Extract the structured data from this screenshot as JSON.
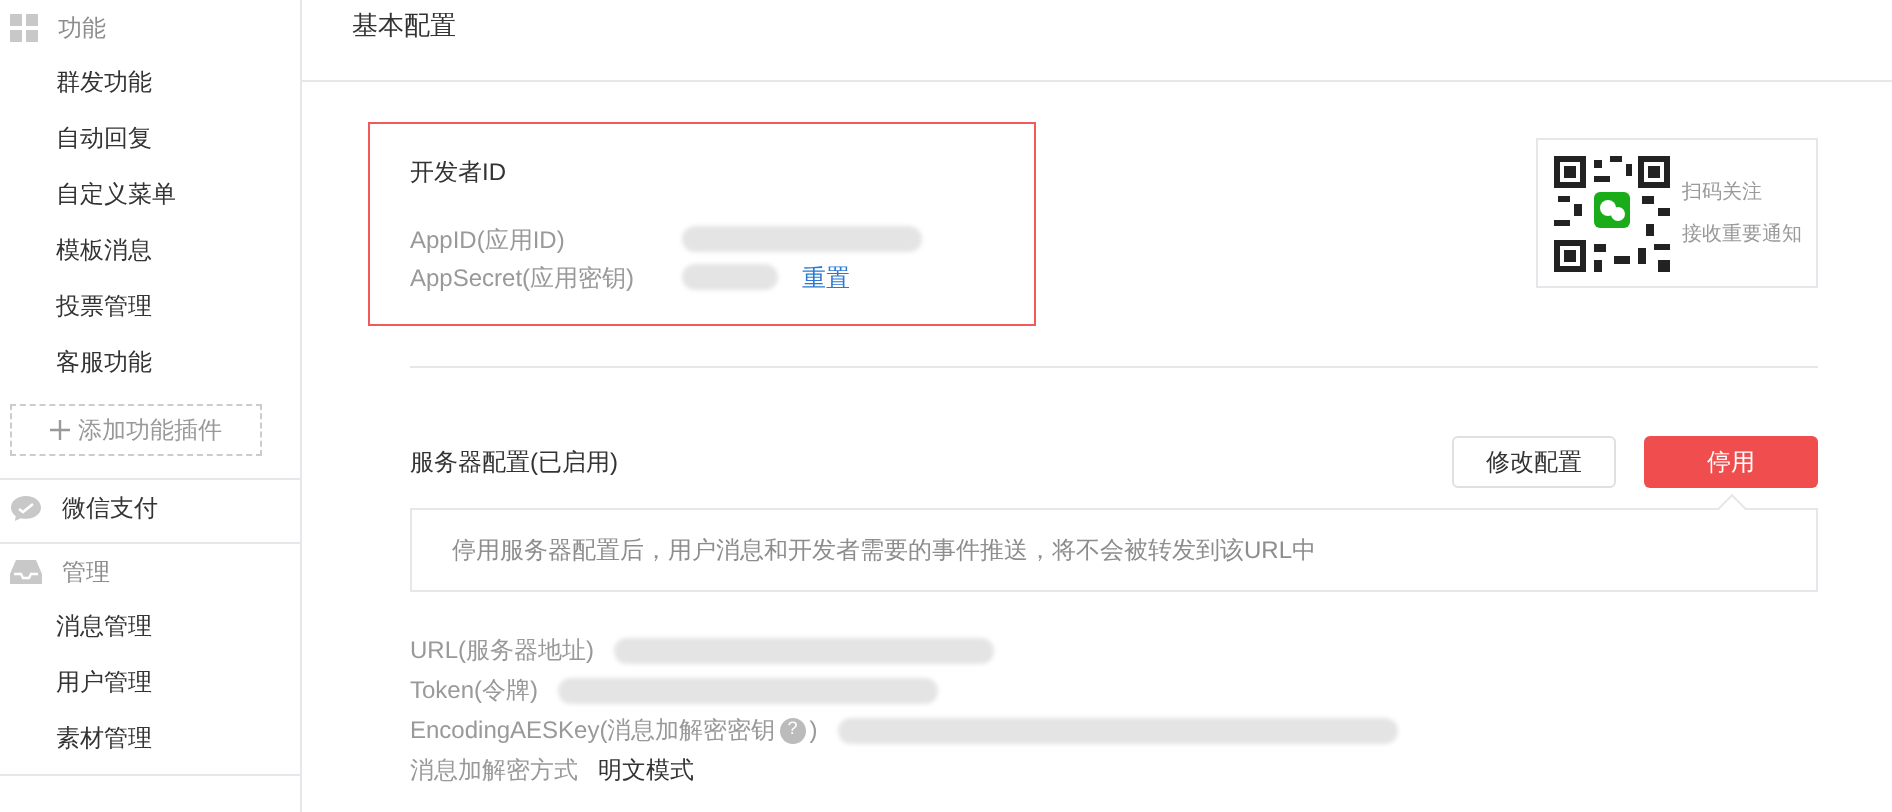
{
  "sidebar": {
    "sections": [
      {
        "kind": "grid",
        "title": "功能",
        "items": [
          {
            "label": "群发功能"
          },
          {
            "label": "自动回复"
          },
          {
            "label": "自定义菜单"
          },
          {
            "label": "模板消息"
          },
          {
            "label": "投票管理"
          },
          {
            "label": "客服功能"
          }
        ],
        "add_button": "添加功能插件"
      },
      {
        "kind": "chat",
        "title": "微信支付"
      },
      {
        "kind": "tray",
        "title": "管理",
        "items": [
          {
            "label": "消息管理"
          },
          {
            "label": "用户管理"
          },
          {
            "label": "素材管理"
          }
        ]
      }
    ]
  },
  "page_title": "基本配置",
  "developer": {
    "title": "开发者ID",
    "rows": [
      {
        "label": "AppID(应用ID)",
        "kind": "hidden"
      },
      {
        "label": "AppSecret(应用密钥)",
        "kind": "hidden-link",
        "action": "重置"
      }
    ]
  },
  "qr_card": {
    "lines": [
      "扫码关注",
      "接收重要通知"
    ]
  },
  "server": {
    "title": "服务器配置(已启用)",
    "buttons": [
      {
        "label": "修改配置",
        "kind": "secondary"
      },
      {
        "label": "停用",
        "kind": "danger"
      }
    ],
    "notice": "停用服务器配置后，用户消息和开发者需要的事件推送，将不会被转发到该URL中",
    "rows": [
      {
        "label": "URL(服务器地址)",
        "kind": "hidden"
      },
      {
        "label": "Token(令牌)",
        "kind": "hidden"
      },
      {
        "label": "EncodingAESKey(消息加解密密钥",
        "help": "?",
        "suffix": ")",
        "kind": "hidden"
      },
      {
        "label": "消息加解密方式",
        "value": "明文模式",
        "kind": "text"
      }
    ]
  }
}
